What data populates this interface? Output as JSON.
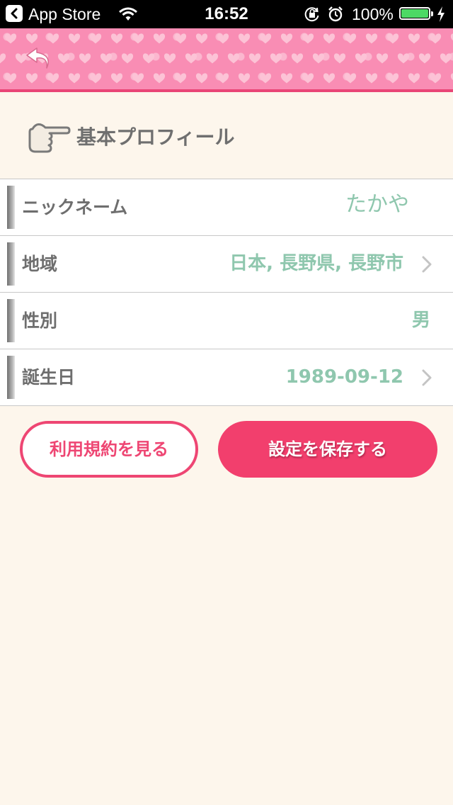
{
  "status_bar": {
    "back_app_label": "App Store",
    "time": "16:52",
    "battery_percent": "100%",
    "battery_level": 1.0,
    "icons": [
      "back-to-app-icon",
      "wifi-icon",
      "orientation-lock-icon",
      "alarm-icon",
      "battery-icon",
      "charging-bolt-icon"
    ]
  },
  "header": {
    "back_icon": "return-arrow-icon",
    "accent_color": "#f98db4"
  },
  "section": {
    "title": "基本プロフィール",
    "icon": "pointing-hand-icon"
  },
  "profile_rows": [
    {
      "label": "ニックネーム",
      "value": "たかや",
      "has_arrow": false
    },
    {
      "label": "地域",
      "value": "日本, 長野県, 長野市",
      "has_arrow": true
    },
    {
      "label": "性別",
      "value": "男",
      "has_arrow": false
    },
    {
      "label": "誕生日",
      "value": "1989-09-12",
      "has_arrow": true
    }
  ],
  "buttons": {
    "terms_label": "利用規約を見る",
    "save_label": "設定を保存する"
  },
  "colors": {
    "value_text": "#8fc7ae",
    "primary_pink": "#f23f6d",
    "background": "#fdf6ec"
  }
}
